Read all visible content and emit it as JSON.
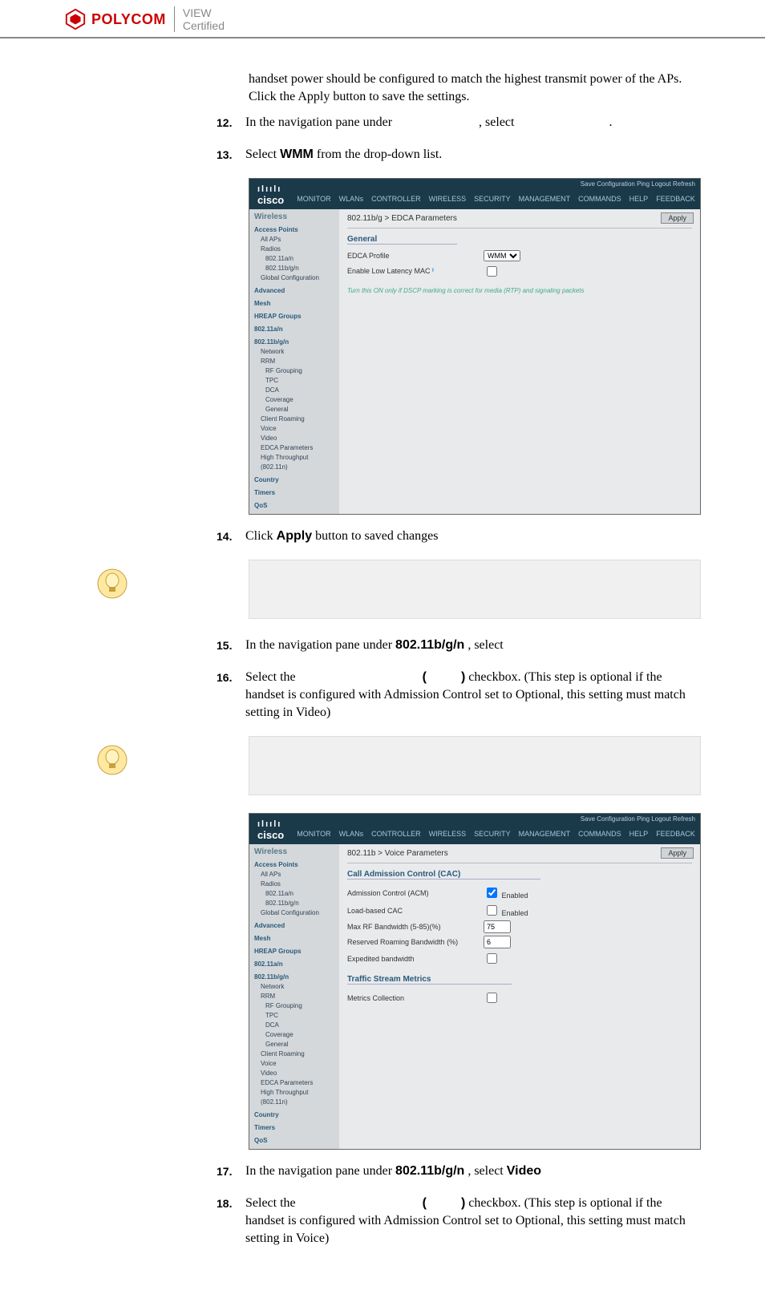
{
  "header": {
    "brand": "POLYCOM",
    "cert_line1": "VIEW",
    "cert_line2": "Certified"
  },
  "intro_para": "handset power should be configured to match the highest transmit power of the APs.  Click the Apply button to save the settings.",
  "steps": {
    "s12": {
      "num": "12.",
      "t1": "In the navigation pane under ",
      "t2": ", select ",
      "t3": "."
    },
    "s13": {
      "num": "13.",
      "t1": "Select ",
      "bold": "WMM",
      "t2": " from the drop-down list."
    },
    "s14": {
      "num": "14.",
      "t1": "Click ",
      "bold": "Apply",
      "t2": " button to saved changes"
    },
    "s15": {
      "num": "15.",
      "t1": "In the navigation pane under ",
      "bold": "802.11b/g/n",
      "t2": ", select"
    },
    "s16": {
      "num": "16.",
      "t1": "Select the ",
      "paren_l": "(",
      "paren_r": ")",
      "t2": " checkbox. (This step is optional if the handset is configured with Admission Control set to Optional, this setting must match setting in Video)"
    },
    "s17": {
      "num": "17.",
      "t1": "In the navigation pane under ",
      "bold": "802.11b/g/n",
      "t2": ", select ",
      "bold2": "Video"
    },
    "s18": {
      "num": "18.",
      "t1": "Select the ",
      "paren_l": "(",
      "paren_r": ")",
      "t2": " checkbox. (This step is optional if the handset is configured with Admission Control set to Optional, this setting must match setting in Voice)"
    }
  },
  "ss_common": {
    "cisco": "cisco",
    "cisco_top": "ılıılı",
    "toplinks": "Save Configuration   Ping   Logout  Refresh",
    "menu": [
      "MONITOR",
      "WLANs",
      "CONTROLLER",
      "WIRELESS",
      "SECURITY",
      "MANAGEMENT",
      "COMMANDS",
      "HELP",
      "FEEDBACK"
    ],
    "apply": "Apply",
    "nav_heading": "Wireless",
    "nav": [
      "Access Points",
      "All APs",
      "Radios",
      "802.11a/n",
      "802.11b/g/n",
      "Global Configuration",
      "Advanced",
      "Mesh",
      "HREAP Groups",
      "802.11a/n",
      "802.11b/g/n",
      "Network",
      "RRM",
      "RF Grouping",
      "TPC",
      "DCA",
      "Coverage",
      "General",
      "Client Roaming",
      "Voice",
      "Video",
      "EDCA Parameters",
      "High Throughput (802.11n)",
      "Country",
      "Timers",
      "QoS"
    ]
  },
  "ss1": {
    "crumb": "802.11b/g > EDCA Parameters",
    "general": "General",
    "row1_label": "EDCA Profile",
    "row1_value": "WMM",
    "row2_label": "Enable Low Latency MAC",
    "note": "Turn this ON only if DSCP marking is correct for media (RTP) and signaling packets"
  },
  "ss2": {
    "crumb": "802.11b > Voice Parameters",
    "sec1": "Call Admission Control (CAC)",
    "r1": "Admission Control (ACM)",
    "r1v": "Enabled",
    "r2": "Load-based CAC",
    "r2v": "Enabled",
    "r3": "Max RF Bandwidth (5-85)(%)",
    "r3v": "75",
    "r4": "Reserved Roaming Bandwidth (%)",
    "r4v": "6",
    "r5": "Expedited bandwidth",
    "sec2": "Traffic Stream Metrics",
    "r6": "Metrics Collection"
  }
}
